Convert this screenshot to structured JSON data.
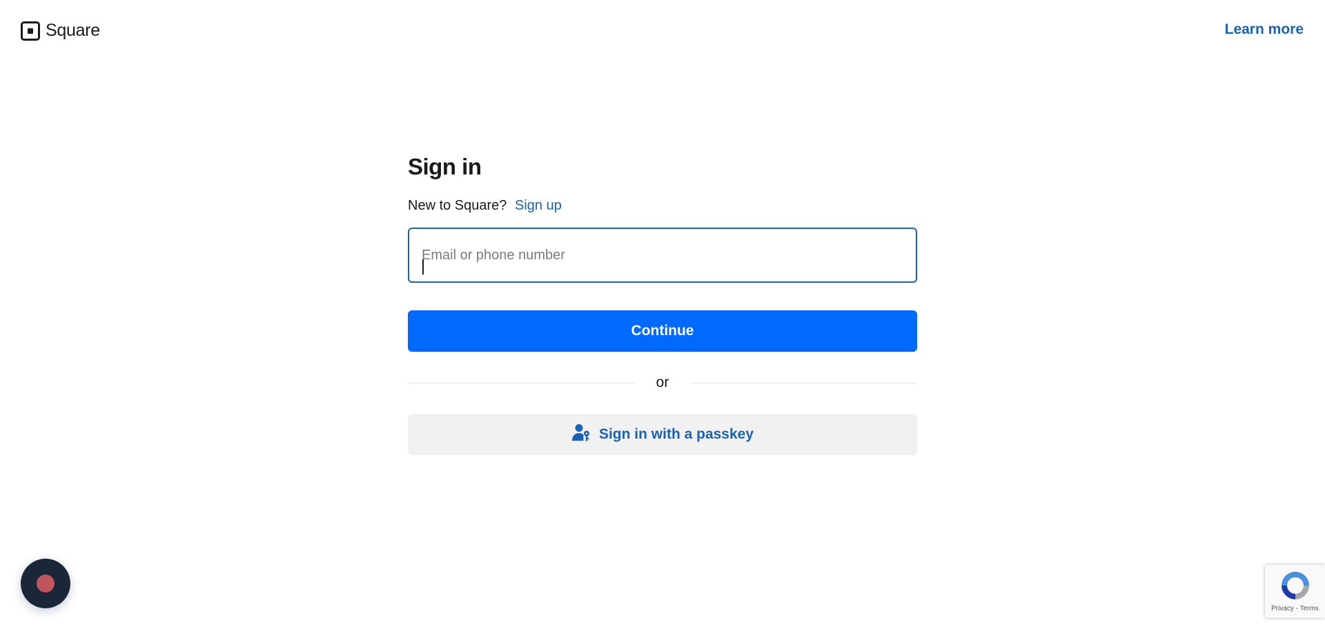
{
  "header": {
    "logo_text": "Square",
    "learn_more": "Learn more"
  },
  "form": {
    "title": "Sign in",
    "new_prompt": "New to Square?",
    "signup_link": "Sign up",
    "input_placeholder": "Email or phone number",
    "input_value": "",
    "continue_label": "Continue",
    "divider_text": "or",
    "passkey_label": "Sign in with a passkey"
  },
  "recaptcha": {
    "terms_text": "Privacy - Terms"
  },
  "colors": {
    "brand_blue": "#006aff",
    "link_blue": "#1a62b5",
    "chat_bubble_bg": "#1b2638",
    "chat_dot": "#c0555e"
  },
  "icons": {
    "logo": "square-logo-icon",
    "passkey": "user-key-icon",
    "chat": "chat-bubble-icon",
    "recaptcha": "recaptcha-icon"
  }
}
